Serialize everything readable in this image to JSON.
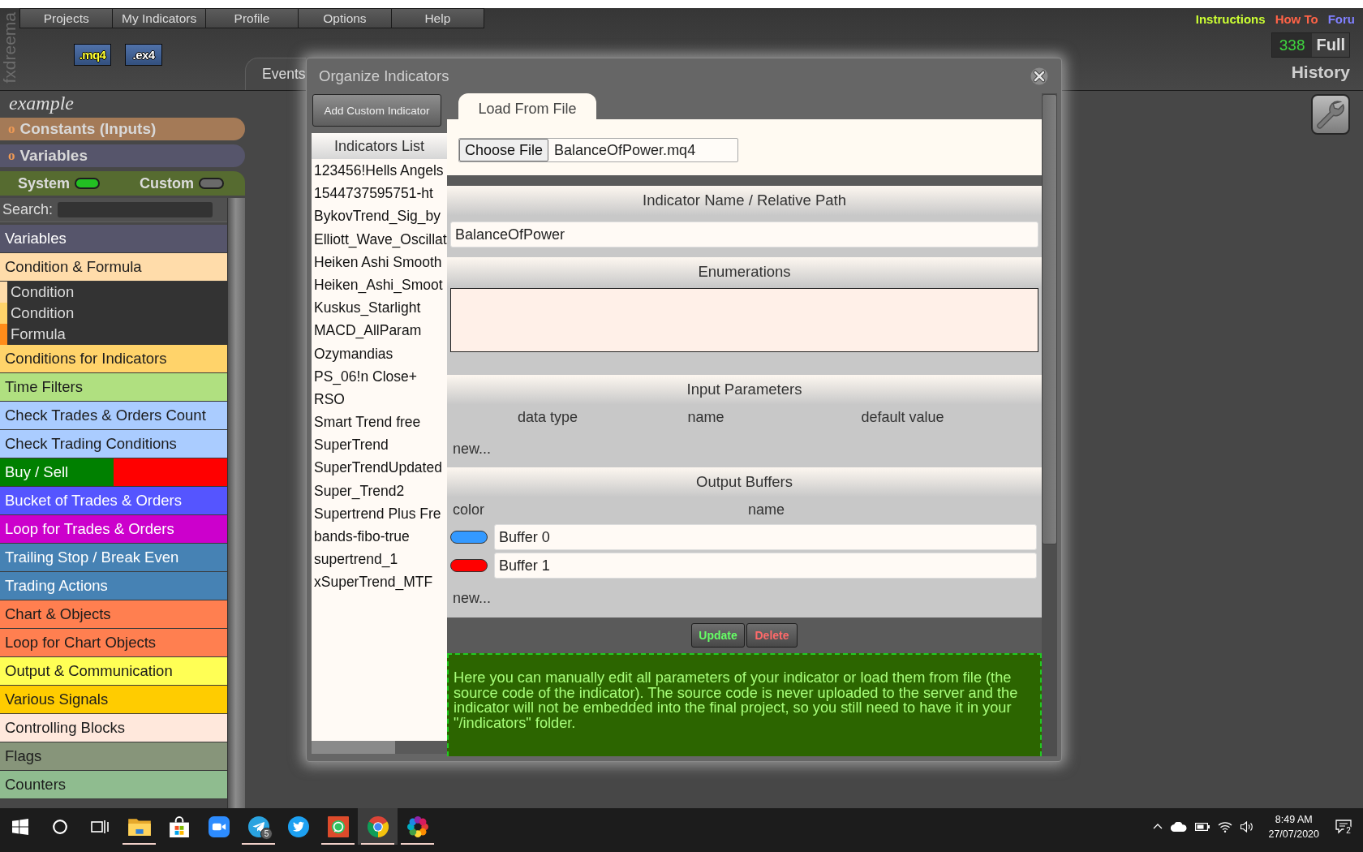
{
  "brand": "fxdreema",
  "menu": [
    {
      "label": "Projects"
    },
    {
      "label": "My Indicators"
    },
    {
      "label": "Profile"
    },
    {
      "label": "Options"
    },
    {
      "label": "Help"
    }
  ],
  "export_buttons": [
    {
      "label": ".mq4",
      "selected": true
    },
    {
      "label": ".ex4",
      "selected": false
    }
  ],
  "top_links": [
    {
      "label": "Instructions",
      "color": "#ccff33"
    },
    {
      "label": "How To",
      "color": "#ff6347"
    },
    {
      "label": "Foru",
      "color": "#8080ff"
    }
  ],
  "counter": {
    "value": "338",
    "label": "Full"
  },
  "history": "History",
  "workspace_tab": "Events",
  "sidebar": {
    "project_name": "example",
    "sections": [
      {
        "marker": "o",
        "label": "Constants (Inputs)",
        "color": "#a47a57"
      },
      {
        "marker": "o",
        "label": "Variables",
        "color": "#56556b"
      }
    ],
    "filters": [
      {
        "label": "System",
        "on": true
      },
      {
        "label": "Custom",
        "on": false
      }
    ],
    "search": {
      "label": "Search:"
    },
    "categories": [
      {
        "label": "Variables",
        "color": "#56556b"
      },
      {
        "label": "Condition & Formula",
        "color": "#ffdcaa",
        "children": [
          {
            "label": "Condition",
            "color": "#ffdcaa"
          },
          {
            "label": "Condition",
            "color": "#ffd36a"
          },
          {
            "label": "Formula",
            "color": "#ff8c1a"
          }
        ]
      },
      {
        "label": "Conditions for Indicators",
        "color": "#ffd36a"
      },
      {
        "label": "Time Filters",
        "color": "#b0e080"
      },
      {
        "label": "Check Trades & Orders Count",
        "color": "#aaccff"
      },
      {
        "label": "Check Trading Conditions",
        "color": "#aaccff"
      },
      {
        "label": "Buy / Sell",
        "color": "#008000",
        "split": {
          "color": "#ff0000"
        }
      },
      {
        "label": "Bucket of Trades & Orders",
        "color": "#5555ff"
      },
      {
        "label": "Loop for Trades & Orders",
        "color": "#cc00cc"
      },
      {
        "label": "Trailing Stop / Break Even",
        "color": "#4682b4"
      },
      {
        "label": "Trading Actions",
        "color": "#4682b4"
      },
      {
        "label": "Chart & Objects",
        "color": "#ff7f50"
      },
      {
        "label": "Loop for Chart Objects",
        "color": "#ff7f50"
      },
      {
        "label": "Output & Communication",
        "color": "#ffff55"
      },
      {
        "label": "Various Signals",
        "color": "#ffcc00"
      },
      {
        "label": "Controlling Blocks",
        "color": "#ffe8dc"
      },
      {
        "label": "Flags",
        "color": "#87957a"
      },
      {
        "label": "Counters",
        "color": "#8fbc8f"
      }
    ]
  },
  "dialog": {
    "title": "Organize Indicators",
    "add_button": "Add Custom Indicator",
    "list_title": "Indicators List",
    "indicators": [
      "123456!Hells Angels",
      "1544737595751-ht",
      "BykovTrend_Sig_by",
      "Elliott_Wave_Oscillat",
      "Heiken Ashi Smooth",
      "Heiken_Ashi_Smoot",
      "Kuskus_Starlight",
      "MACD_AllParam",
      "Ozymandias",
      "PS_06!n Close+",
      "RSO",
      "Smart Trend free",
      "SuperTrend",
      "SuperTrendUpdated",
      "Super_Trend2",
      "Supertrend Plus Fre",
      "bands-fibo-true",
      "supertrend_1",
      "xSuperTrend_MTF"
    ],
    "tab": "Load From File",
    "file_button": "Choose File",
    "file_name": "BalanceOfPower.mq4",
    "sections": [
      {
        "kind": "text",
        "title": "Indicator Name / Relative Path",
        "value": "BalanceOfPower"
      },
      {
        "kind": "textarea",
        "title": "Enumerations"
      },
      {
        "kind": "table",
        "title": "Input Parameters",
        "columns": [
          "data type",
          "name",
          "default value"
        ],
        "new_link": "new..."
      },
      {
        "kind": "buffers",
        "title": "Output Buffers",
        "columns": [
          "color",
          "name"
        ],
        "rows": [
          {
            "color": "#3399ff",
            "name": "Buffer 0"
          },
          {
            "color": "#ff0000",
            "name": "Buffer 1"
          }
        ],
        "new_link": "new..."
      }
    ],
    "actions": [
      {
        "label": "Update",
        "kind": "update"
      },
      {
        "label": "Delete",
        "kind": "delete"
      }
    ],
    "info": "Here you can manually edit all parameters of your indicator or load them from file (the source code of the indicator). The source code is never uploaded to the server and the indicator will not be embedded into the final project, so you still need to have it in your \"/indicators\" folder."
  },
  "taskbar": {
    "apps": [
      {
        "kind": "folder",
        "running": true,
        "selected": false
      },
      {
        "kind": "store",
        "running": false,
        "selected": false
      },
      {
        "kind": "camera",
        "running": false,
        "selected": false
      },
      {
        "kind": "plane",
        "running": true,
        "selected": false,
        "badge": "5"
      },
      {
        "kind": "bird",
        "running": false,
        "selected": false
      },
      {
        "kind": "chat",
        "running": true,
        "selected": false
      },
      {
        "kind": "browser",
        "running": true,
        "selected": true
      },
      {
        "kind": "petals",
        "running": true,
        "selected": false
      }
    ],
    "time": "8:49 AM",
    "date": "27/07/2020",
    "notifications": "2"
  }
}
